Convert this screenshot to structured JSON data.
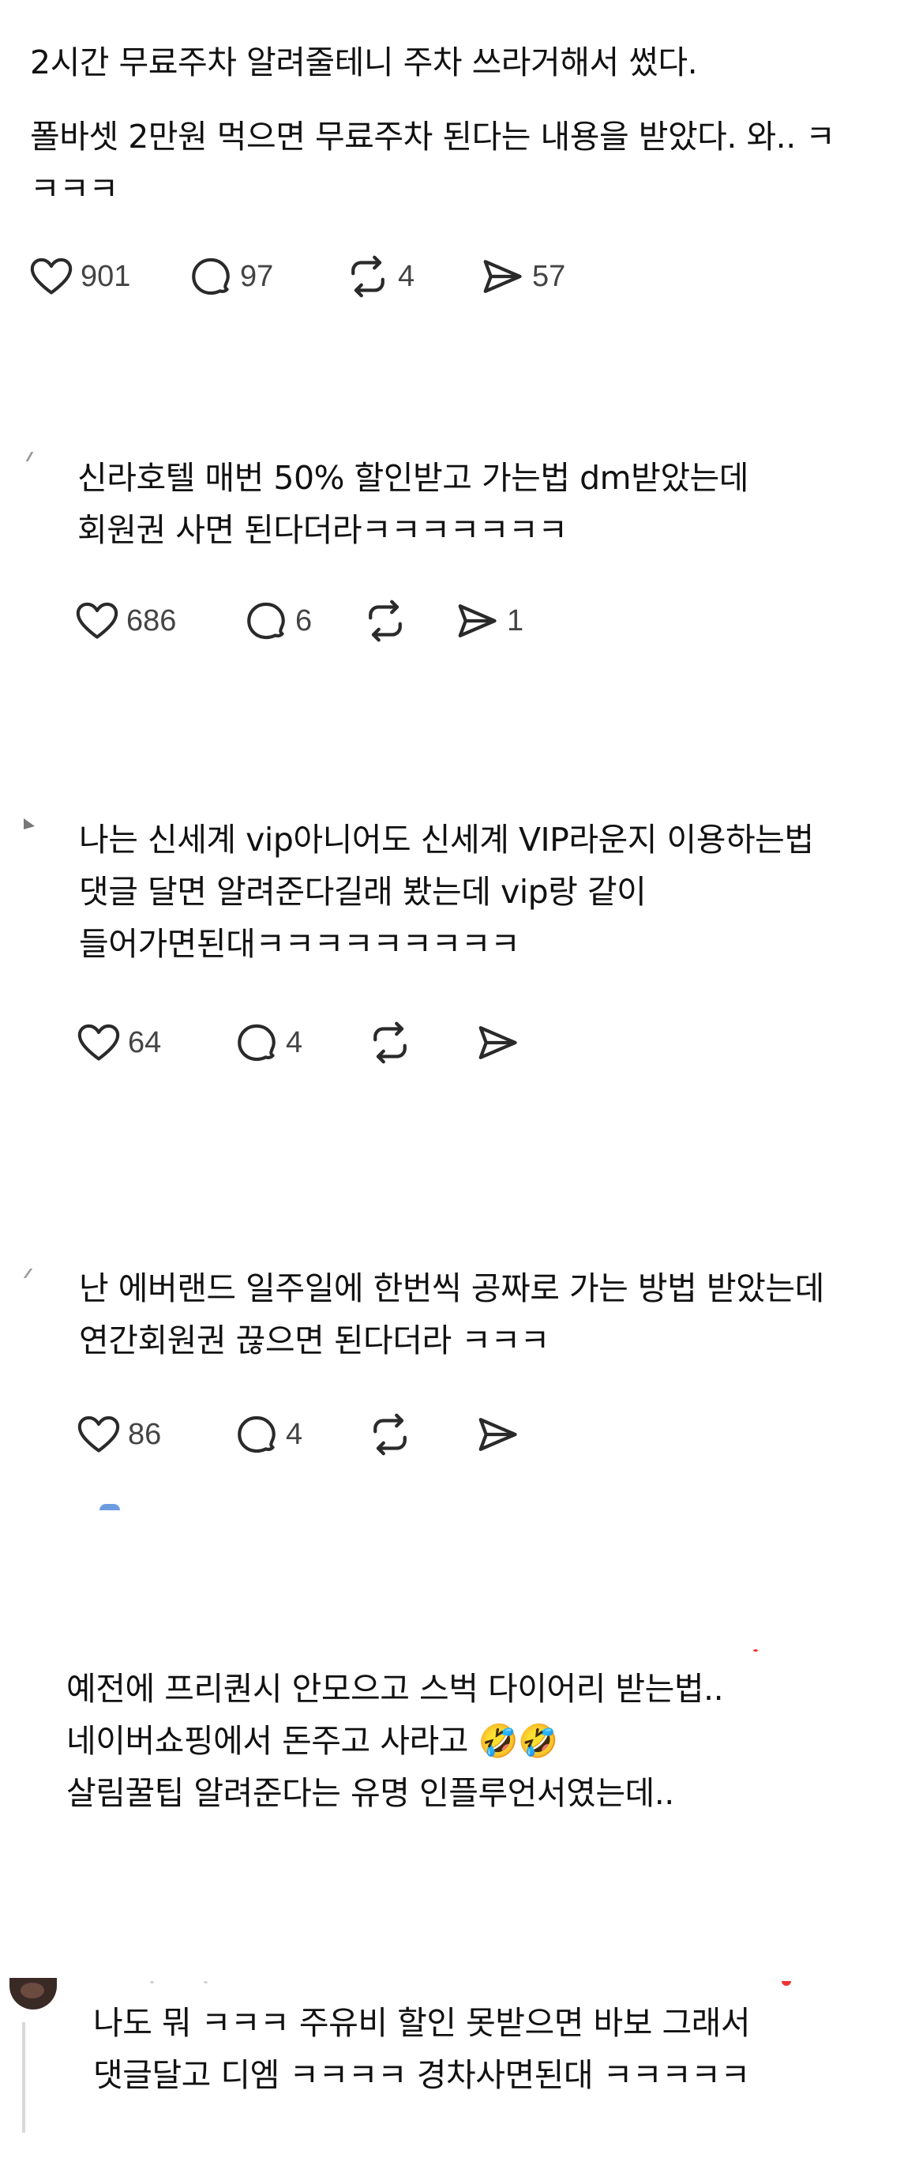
{
  "posts": [
    {
      "text": "2시간 무료주차 알려줄테니 주차 쓰라거해서 썼다.",
      "text2": "폴바셋 2만원 먹으면 무료주차 된다는 내용을 받았다. 와.. ㅋ\nㅋㅋㅋ",
      "likes": "901",
      "replies": "97",
      "reposts": "4",
      "shares": "57"
    },
    {
      "text": "신라호텔 매번 50% 할인받고 가는법 dm받았는데\n회원권 사면 된다더라ㅋㅋㅋㅋㅋㅋㅋ",
      "likes": "686",
      "replies": "6",
      "reposts": "",
      "shares": "1"
    },
    {
      "text": "나는 신세계 vip아니어도 신세계 VIP라운지 이용하는법\n댓글 달면 알려준다길래 봤는데 vip랑 같이\n들어가면된대ㅋㅋㅋㅋㅋㅋㅋㅋㅋ",
      "likes": "64",
      "replies": "4",
      "reposts": "",
      "shares": ""
    },
    {
      "text": "난 에버랜드 일주일에 한번씩 공짜로 가는 방법 받았는데\n연간회원권 끊으면 된다더라 ㅋㅋㅋ",
      "likes": "86",
      "replies": "4",
      "reposts": "",
      "shares": ""
    },
    {
      "text": "예전에 프리퀀시 안모으고 스벅 다이어리 받는법..\n네이버쇼핑에서 돈주고 사라고 🤣🤣\n살림꿀팁 알려준다는 유명 인플루언서였는데.."
    },
    {
      "text": "나도 뭐 ㅋㅋㅋ 주유비 할인 못받으면 바보 그래서\n댓글달고 디엠 ㅋㅋㅋㅋ 경차사면된대 ㅋㅋㅋㅋㅋ"
    }
  ],
  "icons": {
    "like": "heart-icon",
    "reply": "comment-bubble-icon",
    "repost": "repost-arrows-icon",
    "share": "send-paper-plane-icon"
  },
  "colors": {
    "text": "#111111",
    "icon": "#2a2a2a",
    "count": "#444444"
  }
}
